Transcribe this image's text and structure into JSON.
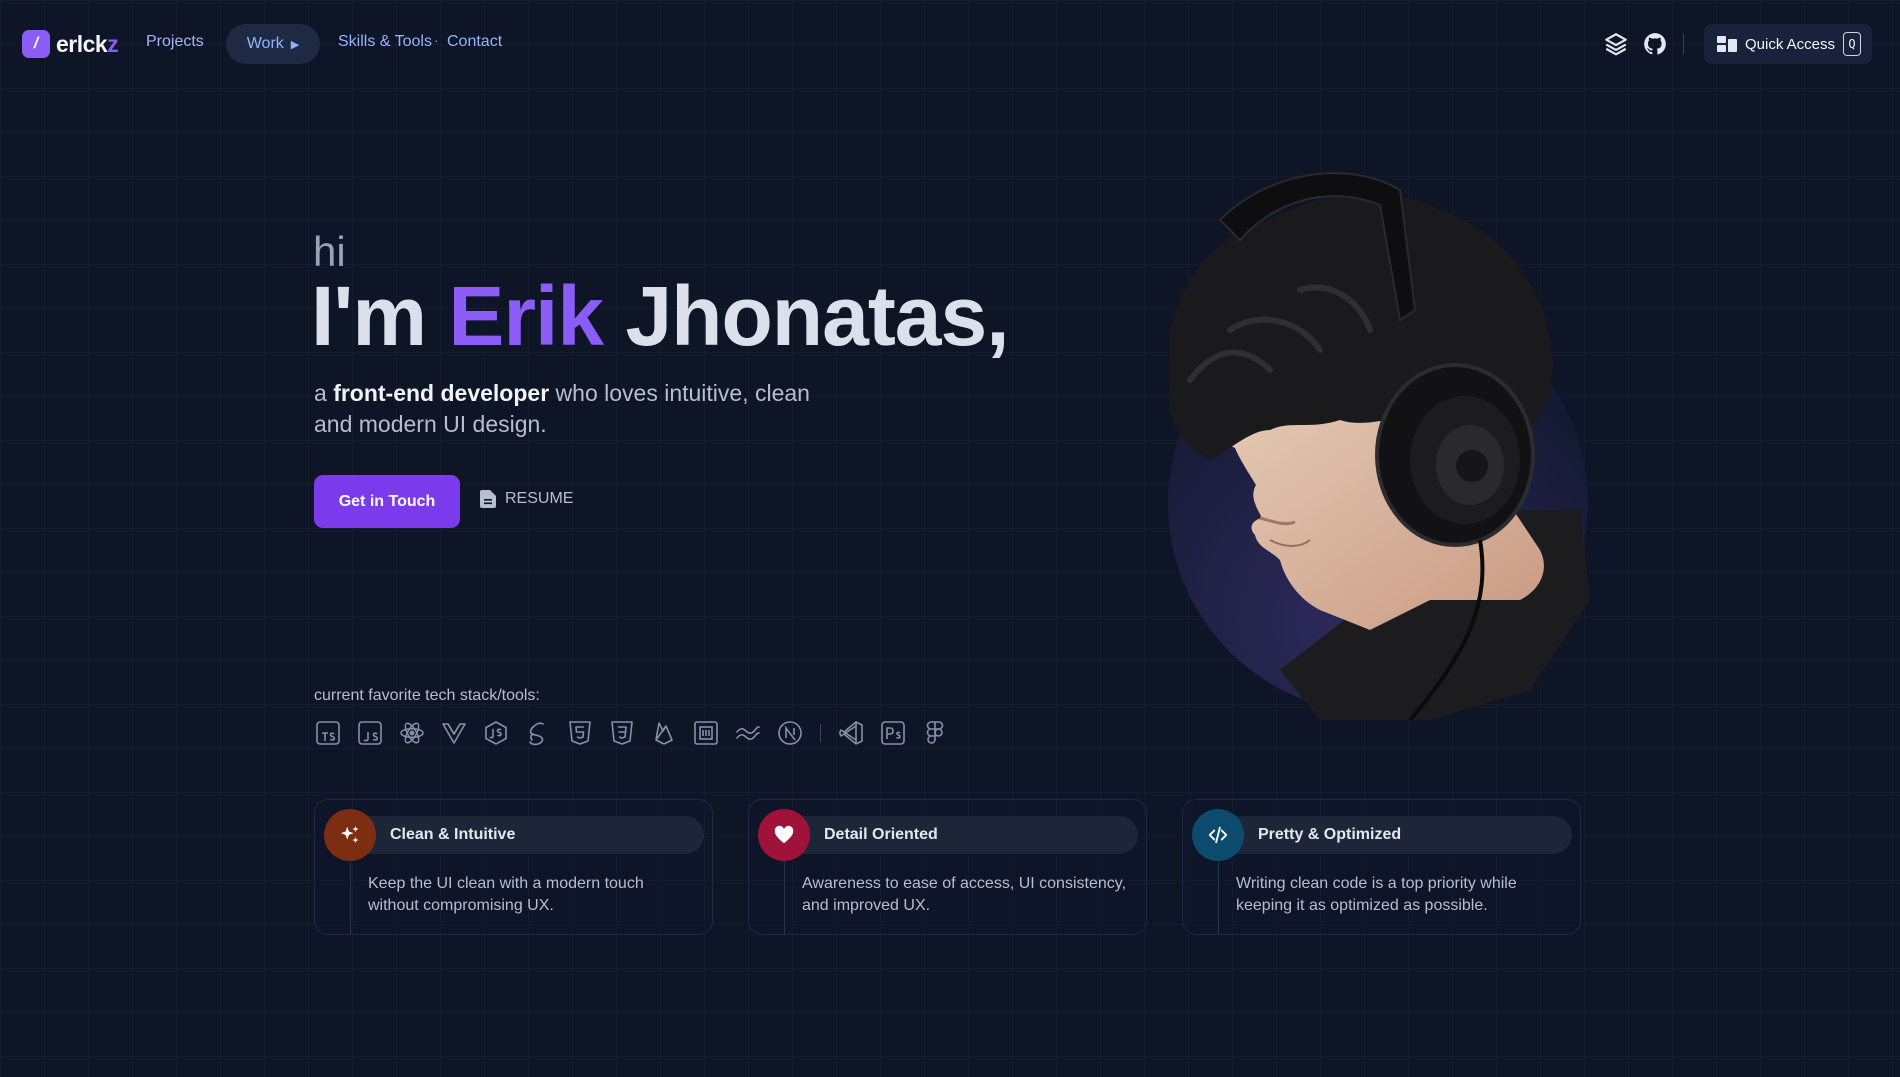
{
  "nav": {
    "logo_mark": "/",
    "logo_main": "erlck",
    "logo_accent": "z",
    "projects": "Projects",
    "work": "Work",
    "skills": "Skills & Tools",
    "dot": "·",
    "contact": "Contact",
    "quick_access": "Quick Access",
    "quick_key": "Q",
    "icons": [
      "layers-icon",
      "github-icon"
    ]
  },
  "hero": {
    "greeting": "hi",
    "headline_pre": "I'm ",
    "headline_name": "Erik",
    "headline_post": " Jhonatas,",
    "tagline_pre": "a ",
    "tagline_bold": "front-end developer",
    "tagline_post": " who loves intuitive, clean and modern UI design.",
    "cta": "Get in Touch",
    "resume": "RESUME"
  },
  "stack": {
    "label": "current favorite tech stack/tools:",
    "tools": [
      "TypeScript",
      "JavaScript",
      "React",
      "Vue",
      "Redux",
      "Svelte",
      "HTML5",
      "CSS3",
      "Firebase",
      "Windi",
      "Tailwind",
      "Next.js",
      "VS Code",
      "Photoshop",
      "Figma"
    ]
  },
  "features": [
    {
      "title": "Clean & Intuitive",
      "desc": "Keep the UI clean with a modern touch without compromising UX.",
      "color": "#7c2d12",
      "icon": "sparkles-icon"
    },
    {
      "title": "Detail Oriented",
      "desc": "Awareness to ease of access, UI consistency, and improved UX.",
      "color": "#9f1239",
      "icon": "heart-icon"
    },
    {
      "title": "Pretty & Optimized",
      "desc": "Writing clean code is a top priority while keeping it as optimized as possible.",
      "color": "#0c4a6e",
      "icon": "code-icon"
    }
  ],
  "colors": {
    "accent": "#8b5cf6",
    "background": "#0e1527",
    "button": "#7c3aed"
  }
}
